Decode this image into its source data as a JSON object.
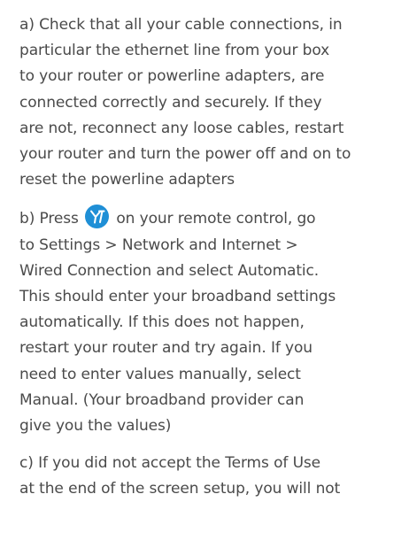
{
  "paragraphs": [
    {
      "lines": [
        "a) Check that all your cable connections, in",
        "particular the ethernet line from your box",
        "to your router or powerline adapters, are",
        "connected correctly and securely. If they",
        "are not, reconnect any loose cables, restart",
        "your router and turn the power off and on to",
        "reset the powerline adapters"
      ]
    },
    {
      "first_line_before_icon": "b) Press",
      "first_line_after_icon": "on your remote control, go",
      "icon": "youview-button-icon",
      "icon_color": "#1f8fd6",
      "lines": [
        "to Settings > Network and Internet >",
        "Wired Connection and select Automatic.",
        "This should enter your broadband settings",
        "automatically. If this does not happen,",
        "restart your router and try again. If you",
        "need to enter values manually, select",
        "Manual. (Your broadband provider can",
        "give you the values)"
      ]
    },
    {
      "lines": [
        "c) If you did not accept the Terms of Use",
        "at the end of the screen setup, you will not"
      ]
    }
  ],
  "colors": {
    "text": "#4a4a4a",
    "background": "#ffffff"
  }
}
